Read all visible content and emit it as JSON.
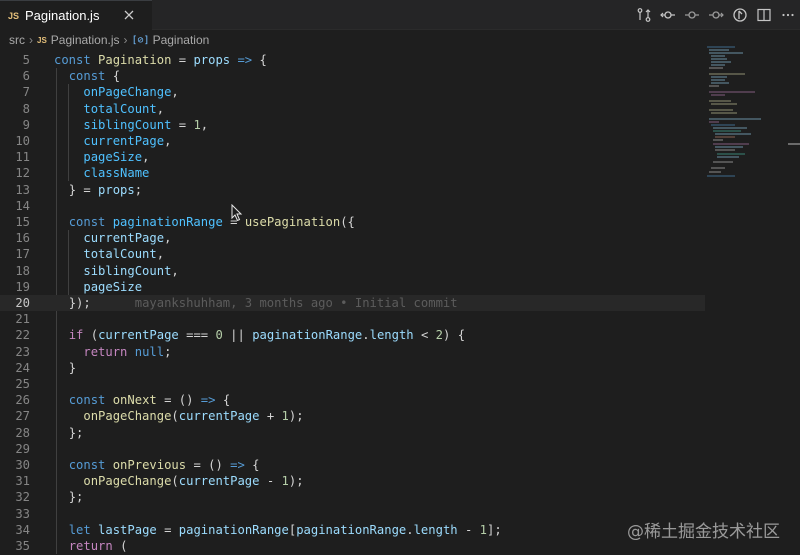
{
  "tab": {
    "badge": "JS",
    "title": "Pagination.js"
  },
  "breadcrumb": {
    "folder": "src",
    "file_badge": "JS",
    "file": "Pagination.js",
    "symbol": "Pagination"
  },
  "editor": {
    "lines": [
      {
        "num": "5"
      },
      {
        "num": "6"
      },
      {
        "num": "7"
      },
      {
        "num": "8"
      },
      {
        "num": "9"
      },
      {
        "num": "10"
      },
      {
        "num": "11"
      },
      {
        "num": "12"
      },
      {
        "num": "13"
      },
      {
        "num": "14"
      },
      {
        "num": "15"
      },
      {
        "num": "16"
      },
      {
        "num": "17"
      },
      {
        "num": "18"
      },
      {
        "num": "19"
      },
      {
        "num": "20"
      },
      {
        "num": "21"
      },
      {
        "num": "22"
      },
      {
        "num": "23"
      },
      {
        "num": "24"
      },
      {
        "num": "25"
      },
      {
        "num": "26"
      },
      {
        "num": "27"
      },
      {
        "num": "28"
      },
      {
        "num": "29"
      },
      {
        "num": "30"
      },
      {
        "num": "31"
      },
      {
        "num": "32"
      },
      {
        "num": "33"
      },
      {
        "num": "34"
      },
      {
        "num": "35"
      }
    ],
    "t": {
      "const": "const",
      "Pagination": "Pagination",
      "props": "props",
      "arrow": "=>",
      "onPageChange": "onPageChange",
      "totalCount": "totalCount",
      "siblingCount": "siblingCount",
      "one": "1",
      "currentPage": "currentPage",
      "pageSize": "pageSize",
      "className": "className",
      "paginationRange": "paginationRange",
      "usePagination": "usePagination",
      "if": "if",
      "zero": "0",
      "length": "length",
      "two": "2",
      "return": "return",
      "null": "null",
      "onNext": "onNext",
      "onPrevious": "onPrevious",
      "let": "let",
      "lastPage": "lastPage"
    },
    "blame": "mayankshuhham, 3 months ago • Initial commit"
  },
  "watermark": "@稀土掘金技术社区",
  "colors": {
    "keyword": "#569cd6",
    "control": "#c586c0",
    "variable": "#9cdcfe",
    "function": "#dcdcaa",
    "number": "#b5cea8"
  }
}
